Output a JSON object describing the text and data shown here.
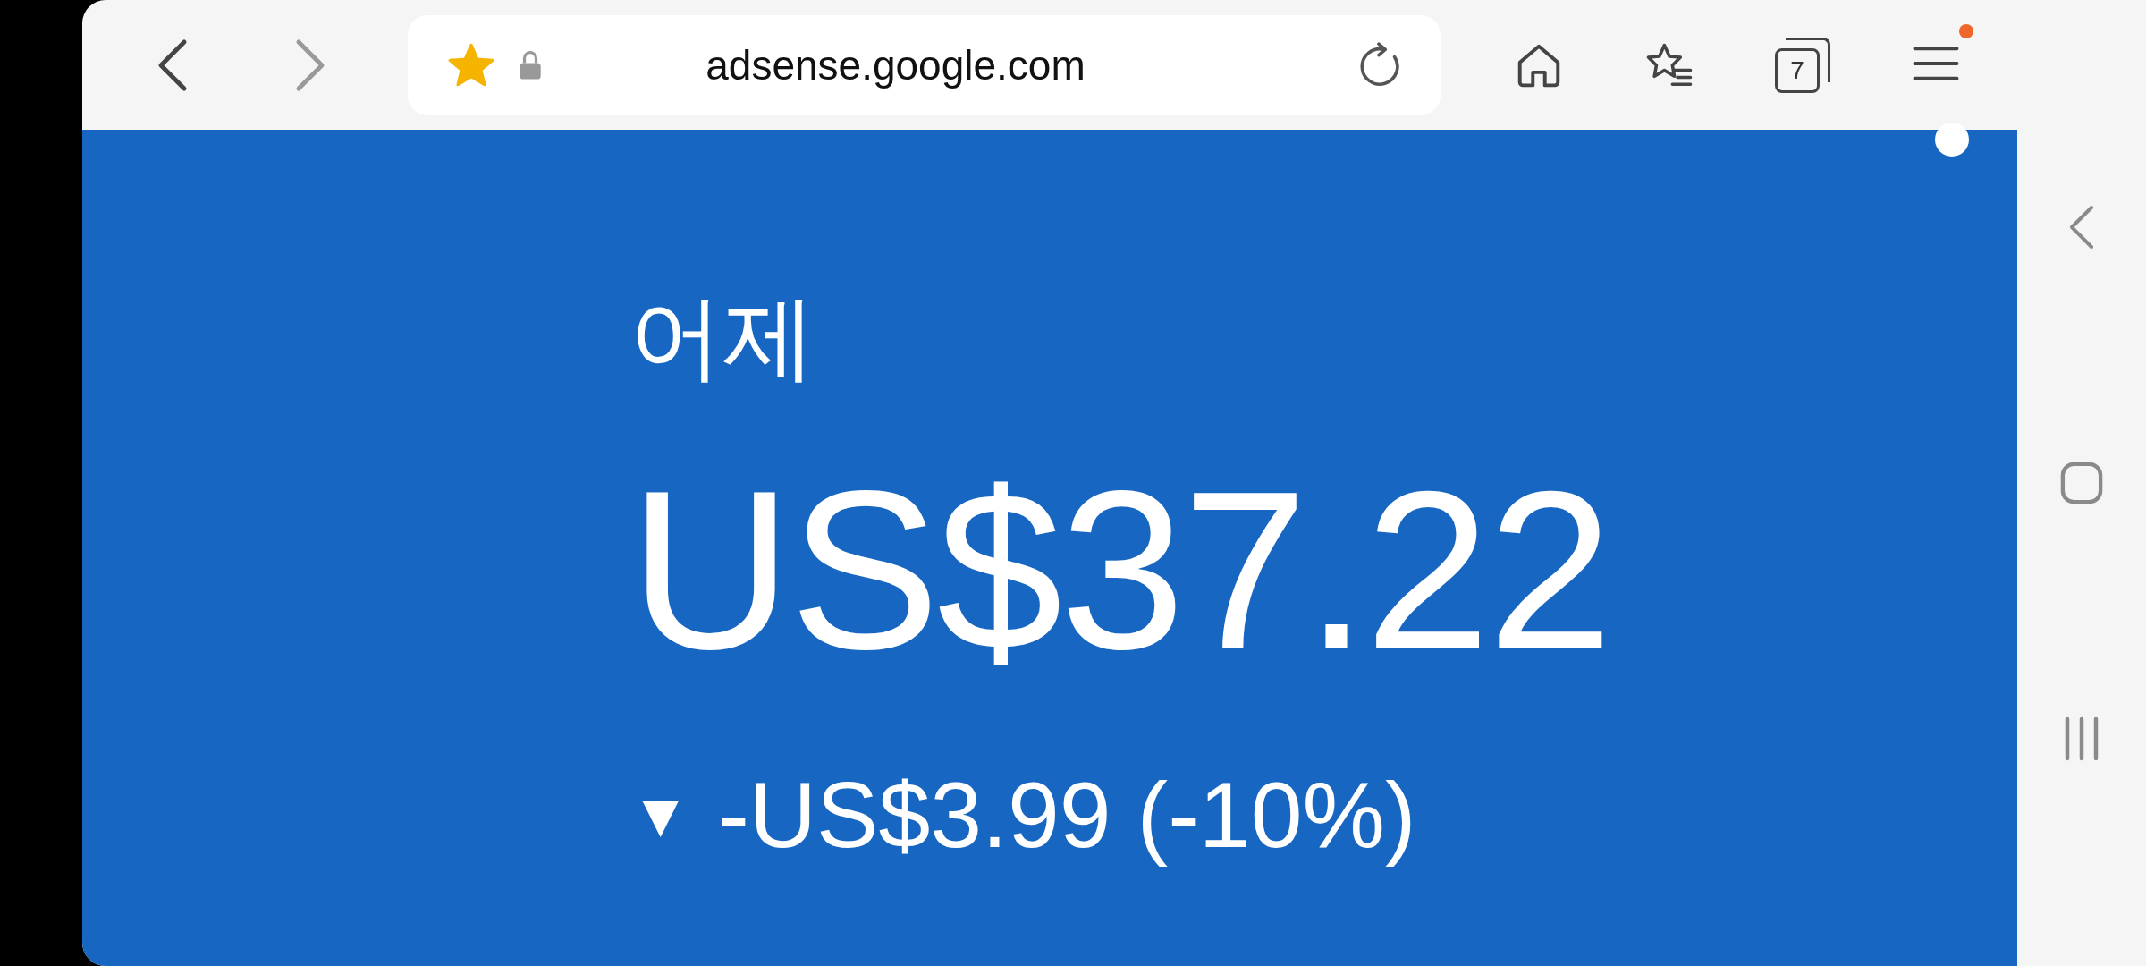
{
  "toolbar": {
    "url": "adsense.google.com",
    "bookmarked": true,
    "tab_count": "7",
    "menu_badge": true
  },
  "earnings": {
    "period": "어제",
    "amount": "US$37.22",
    "change_arrow": "▼",
    "change": "-US$3.99 (-10%)"
  }
}
